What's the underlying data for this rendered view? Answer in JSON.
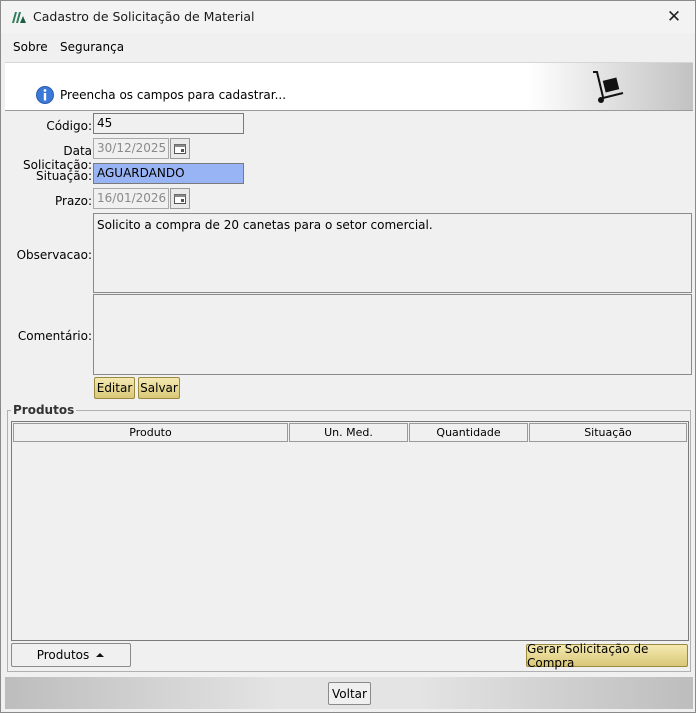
{
  "window": {
    "title": "Cadastro de Solicitação de Material",
    "close_label": "✕"
  },
  "menu": {
    "sobre": "Sobre",
    "seguranca": "Segurança"
  },
  "banner": {
    "message": "Preencha os campos para cadastrar..."
  },
  "form": {
    "codigo_label": "Código:",
    "codigo_value": "45",
    "data_label": "Data Solicitação:",
    "data_value": "30/12/2025",
    "situacao_label": "Situação:",
    "situacao_value": "AGUARDANDO",
    "prazo_label": "Prazo:",
    "prazo_value": "16/01/2026",
    "observacao_label": "Observacao:",
    "observacao_value": "Solicito a compra de 20 canetas para o setor comercial.",
    "comentario_label": "Comentário:",
    "comentario_value": ""
  },
  "actions": {
    "editar": "Editar",
    "salvar": "Salvar"
  },
  "produtos": {
    "group_title": "Produtos",
    "columns": [
      "Produto",
      "Un. Med.",
      "Quantidade",
      "Situação"
    ],
    "rows": [],
    "menu_button": "Produtos",
    "gerar_button": "Gerar Solicitação de Compra"
  },
  "footer": {
    "voltar": "Voltar"
  },
  "colors": {
    "selection": "#99b4f4",
    "button_yellow": "#e6d690"
  },
  "icons": {
    "app": "app-logo-icon",
    "info": "info-icon",
    "truck": "hand-truck-icon",
    "calendar": "calendar-icon",
    "arrow": "caret-up-icon"
  }
}
